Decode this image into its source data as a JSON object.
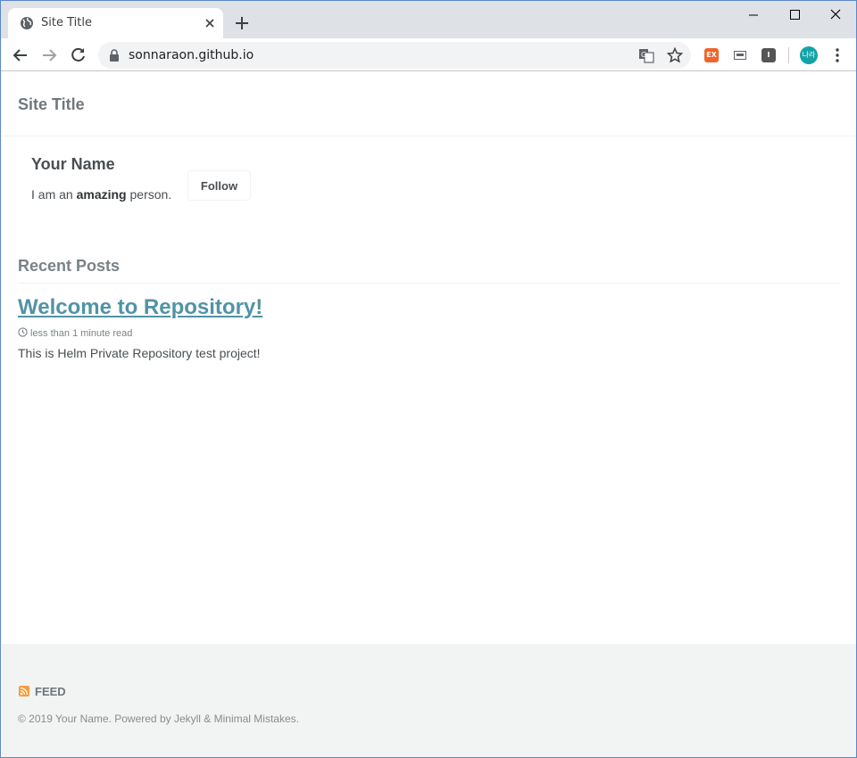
{
  "browser": {
    "tab_title": "Site Title",
    "url": "sonnaraon.github.io",
    "profile_initials": "나라",
    "extension_ex_label": "EX",
    "extension_i_label": "I"
  },
  "site": {
    "title": "Site Title"
  },
  "author": {
    "name": "Your Name",
    "bio_prefix": "I am an ",
    "bio_bold": "amazing",
    "bio_suffix": " person.",
    "follow_label": "Follow"
  },
  "recent": {
    "heading": "Recent Posts"
  },
  "post": {
    "title": "Welcome to Repository!",
    "read_time": "less than 1 minute read",
    "excerpt": "This is Helm Private Repository test project!"
  },
  "footer": {
    "feed_label": "FEED",
    "copyright": "© 2019 Your Name. Powered by Jekyll & Minimal Mistakes."
  },
  "colors": {
    "link": "#5193a6",
    "footer_bg": "#f2f3f3",
    "rss": "#fa9b39",
    "avatar": "#14a2a7"
  }
}
